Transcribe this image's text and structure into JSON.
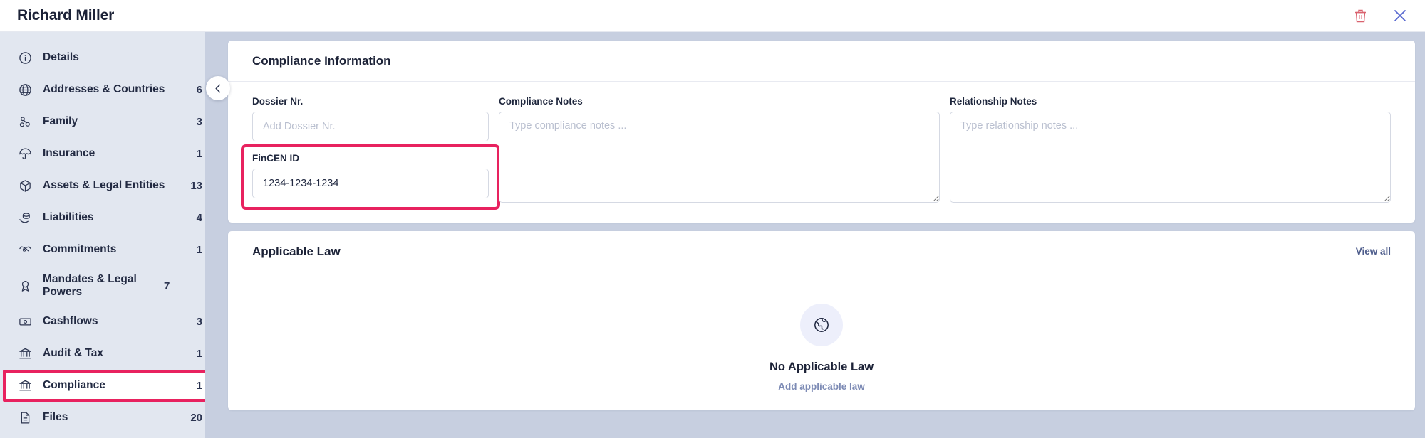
{
  "header": {
    "title": "Richard Miller",
    "delete_icon": "trash-icon",
    "close_icon": "close-icon"
  },
  "sidebar": {
    "collapse_icon": "chevron-left-icon",
    "items": [
      {
        "label": "Details",
        "count": "",
        "icon": "info-circle-icon",
        "active": false
      },
      {
        "label": "Addresses & Countries",
        "count": "6",
        "icon": "globe-icon",
        "active": false
      },
      {
        "label": "Family",
        "count": "3",
        "icon": "family-icon",
        "active": false
      },
      {
        "label": "Insurance",
        "count": "1",
        "icon": "umbrella-icon",
        "active": false
      },
      {
        "label": "Assets & Legal Entities",
        "count": "13",
        "icon": "box-icon",
        "active": false
      },
      {
        "label": "Liabilities",
        "count": "4",
        "icon": "coins-hand-icon",
        "active": false
      },
      {
        "label": "Commitments",
        "count": "1",
        "icon": "handshake-icon",
        "active": false
      },
      {
        "label": "Mandates & Legal Powers",
        "count": "7",
        "icon": "award-person-icon",
        "active": false
      },
      {
        "label": "Cashflows",
        "count": "3",
        "icon": "banknote-icon",
        "active": false
      },
      {
        "label": "Audit & Tax",
        "count": "1",
        "icon": "bank-icon",
        "active": false
      },
      {
        "label": "Compliance",
        "count": "1",
        "icon": "bank-icon",
        "active": true
      },
      {
        "label": "Files",
        "count": "20",
        "icon": "file-icon",
        "active": false
      }
    ]
  },
  "compliance_card": {
    "title": "Compliance Information",
    "dossier": {
      "label": "Dossier Nr.",
      "value": "",
      "placeholder": "Add Dossier Nr."
    },
    "fincen": {
      "label": "FinCEN ID",
      "value": "1234-1234-1234",
      "placeholder": ""
    },
    "compliance_notes": {
      "label": "Compliance Notes",
      "value": "",
      "placeholder": "Type compliance notes ..."
    },
    "relationship_notes": {
      "label": "Relationship Notes",
      "value": "",
      "placeholder": "Type relationship notes ..."
    }
  },
  "applicable_law_card": {
    "title": "Applicable Law",
    "view_all": "View all",
    "empty_icon": "globe-icon",
    "empty_title": "No Applicable Law",
    "empty_action": "Add applicable law"
  },
  "colors": {
    "accent_highlight": "#e8225f",
    "sidebar_bg": "#e2e7f0",
    "content_bg": "#c7cfe0",
    "text_primary": "#1c2237",
    "link": "#4e5d8c",
    "delete": "#d9626f"
  }
}
